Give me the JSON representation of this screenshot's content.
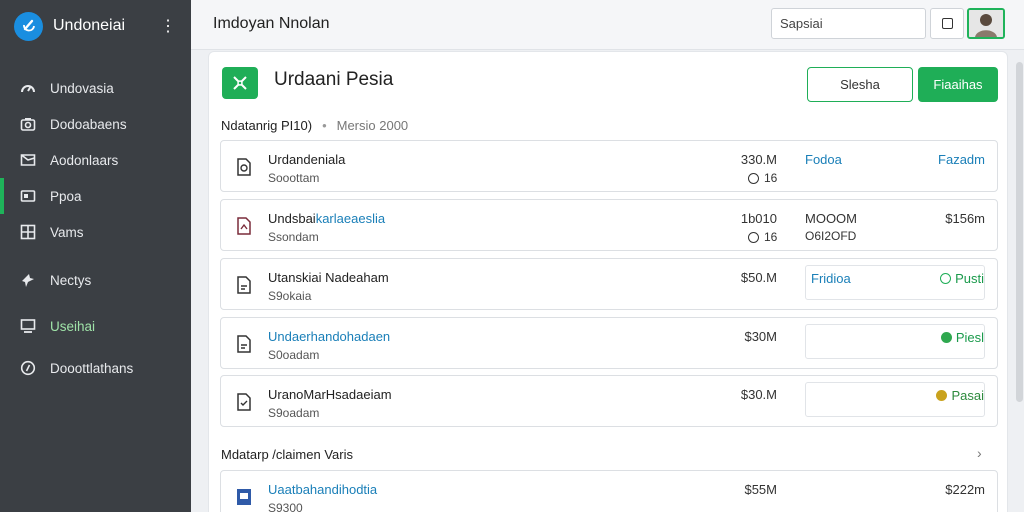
{
  "app": {
    "name": "Undoneiai",
    "window_title": "Imdoyan Nnolan"
  },
  "colors": {
    "accent": "#1fae57",
    "sidebar_bg": "#3b3f44",
    "link": "#1a7fb8"
  },
  "sidebar": {
    "items": [
      {
        "label": "Undovasia",
        "icon": "gauge-icon"
      },
      {
        "label": "Dodoabaens",
        "icon": "camera-icon"
      },
      {
        "label": "Aodonlaars",
        "icon": "inbox-icon"
      },
      {
        "label": "Ppoa",
        "icon": "image-icon"
      },
      {
        "label": "Vams",
        "icon": "grid-icon"
      },
      {
        "label": "Nectys",
        "icon": "pin-icon"
      },
      {
        "label": "Useihai",
        "icon": "monitor-icon"
      },
      {
        "label": "Dooottlathans",
        "icon": "help-circle-icon"
      }
    ]
  },
  "topbar": {
    "search_placeholder": "Sapsiai"
  },
  "header": {
    "title": "Urdaani Pesia",
    "btn_outline": "Slesha",
    "btn_primary": "Fiaaihas"
  },
  "meta": {
    "label": "Ndatanrig PI10)",
    "separator": "•",
    "version": "Mersio 2000"
  },
  "rows": [
    {
      "name": "Urdandeniala",
      "sub": "Sooottam",
      "size": "330.M",
      "extra": "16",
      "col3": "Fodoa",
      "right": "Fazadm"
    },
    {
      "name_a": "Undsbai",
      "name_b": "karlaeaeslia",
      "sub": "Ssondam",
      "size": "1b010",
      "extra": "16",
      "col3": "MOOOM",
      "col3b": "O6I2OFD",
      "right": "$156m"
    },
    {
      "name": "Utanskiai Nadeaham",
      "sub": "S9okaia",
      "size": "$50.M",
      "status_left": "Fridioa",
      "status_right": "Pusti"
    },
    {
      "name": "Undaerhandohadaen",
      "sub": "S0oadam",
      "size": "$30M",
      "status_right": "Piesl"
    },
    {
      "name": "UranoMarHsadaeiam",
      "sub": "S9oadam",
      "size": "$30.M",
      "status_right": "Pasai"
    }
  ],
  "section": {
    "title": "Mdatarp /claimen Varis",
    "chevron": "›"
  },
  "last_row": {
    "name": "Uaatbahandihodtia",
    "sub": "S9300",
    "size": "$55M",
    "right": "$222m"
  }
}
